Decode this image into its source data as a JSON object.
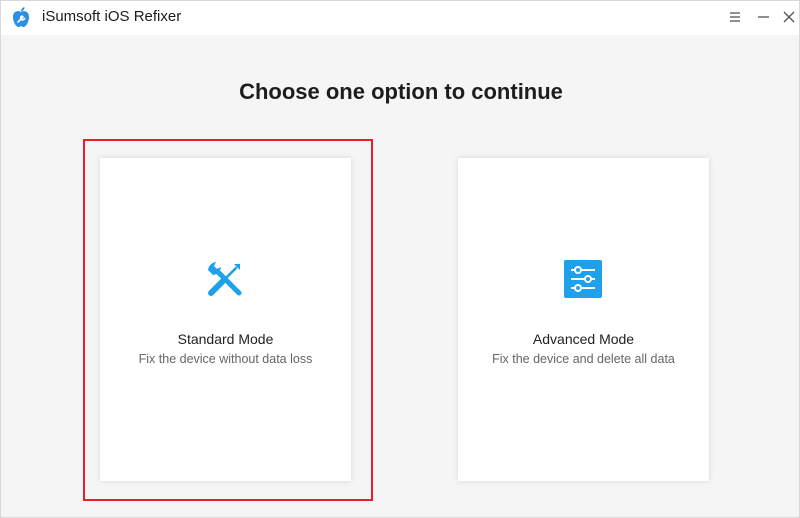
{
  "window": {
    "title": "iSumsoft iOS Refixer",
    "icons": {
      "logo": "apple-wrench-logo-icon",
      "menu": "hamburger-menu-icon",
      "minimize": "minimize-icon",
      "close": "close-icon"
    }
  },
  "main": {
    "heading": "Choose one option to continue",
    "options": [
      {
        "title": "Standard Mode",
        "description": "Fix the device without data loss",
        "icon": "wrench-screwdriver-icon",
        "selected": true
      },
      {
        "title": "Advanced Mode",
        "description": "Fix the device and delete all data",
        "icon": "sliders-settings-icon",
        "selected": false
      }
    ]
  },
  "colors": {
    "accent": "#1ea0ea",
    "selection_outline": "#e8202a",
    "logo_blue": "#2a8fe6"
  }
}
